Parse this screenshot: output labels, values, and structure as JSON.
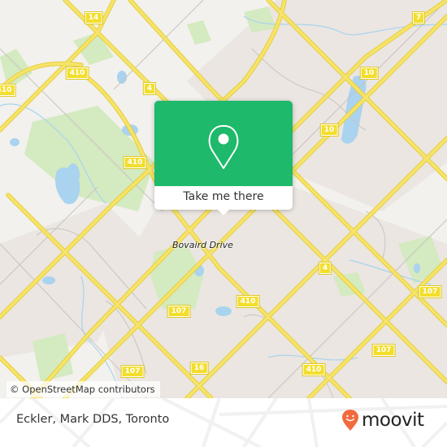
{
  "map": {
    "place_label": "Bovaird Drive",
    "attribution": "© OpenStreetMap contributors",
    "shields": [
      {
        "label": "14"
      },
      {
        "label": "410"
      },
      {
        "label": "410"
      },
      {
        "label": "4"
      },
      {
        "label": "410"
      },
      {
        "label": "410"
      },
      {
        "label": "10"
      },
      {
        "label": "10"
      },
      {
        "label": "7"
      },
      {
        "label": "4"
      },
      {
        "label": "410"
      },
      {
        "label": "107"
      },
      {
        "label": "107"
      },
      {
        "label": "107"
      },
      {
        "label": "107"
      },
      {
        "label": "16"
      },
      {
        "label": "410"
      },
      {
        "label": "107"
      }
    ],
    "colors": {
      "land": "#f2f1ed",
      "urban": "#ebe6e2",
      "park": "#d4eac0",
      "water": "#a9d3ef",
      "highway": "#f3de5a",
      "road": "#c8c4bf"
    }
  },
  "popup": {
    "icon": "map-pin-icon",
    "button_label": "Take me there",
    "color": "#1eb96a"
  },
  "footer": {
    "title": "Eckler, Mark DDS, Toronto",
    "logo_text": "moovit",
    "logo_color": "#f26a3d"
  }
}
